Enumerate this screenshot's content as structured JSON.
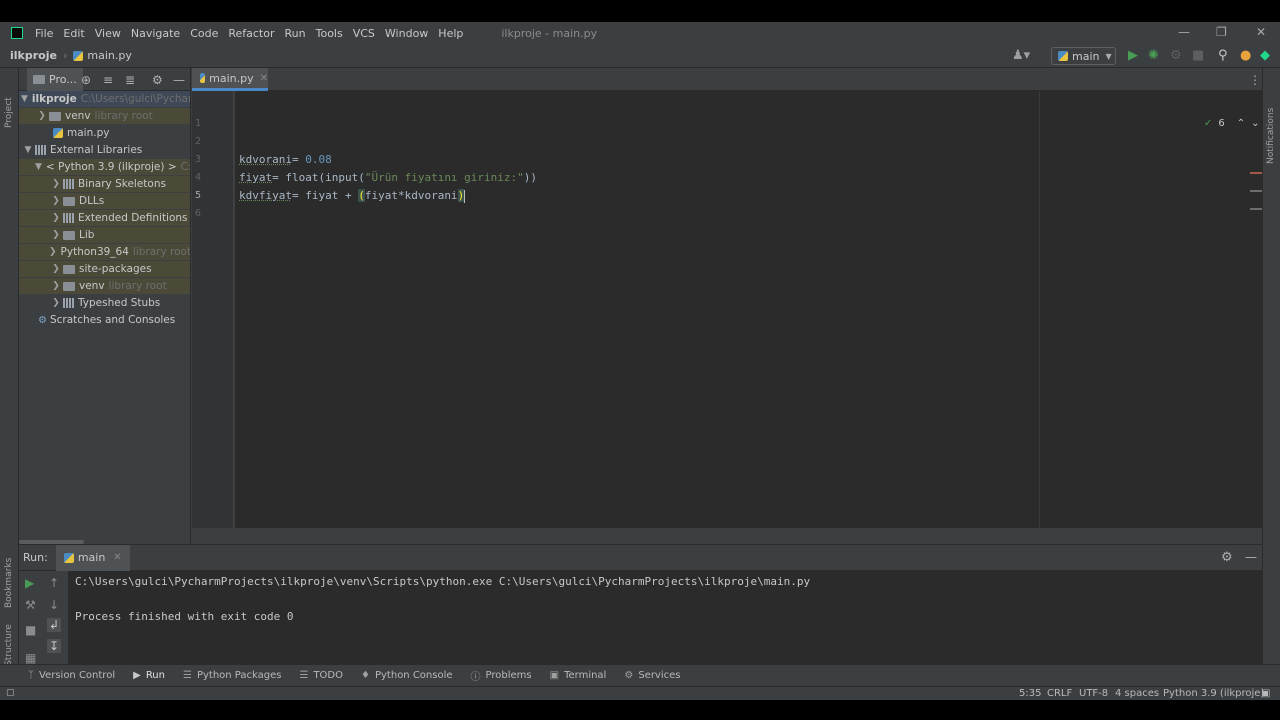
{
  "menu": {
    "items": [
      "File",
      "Edit",
      "View",
      "Navigate",
      "Code",
      "Refactor",
      "Run",
      "Tools",
      "VCS",
      "Window",
      "Help"
    ],
    "window_title": "ilkproje - main.py"
  },
  "navbar": {
    "project": "ilkproje",
    "file": "main.py",
    "run_config": "main"
  },
  "left_stripe": {
    "project": "Project",
    "bookmarks": "Bookmarks",
    "structure": "Structure"
  },
  "right_stripe": {
    "notifications": "Notifications"
  },
  "project_panel": {
    "tab_label": "Pro...",
    "tree": [
      {
        "label": "ilkproje",
        "hint": "C:\\Users\\gulci\\PycharmProjects\\ilkproje"
      },
      {
        "label": "venv",
        "hint": "library root"
      },
      {
        "label": "main.py",
        "hint": ""
      },
      {
        "label": "External Libraries",
        "hint": ""
      },
      {
        "label": "< Python 3.9 (ilkproje) >",
        "hint": "C:\\"
      },
      {
        "label": "Binary Skeletons",
        "hint": ""
      },
      {
        "label": "DLLs",
        "hint": ""
      },
      {
        "label": "Extended Definitions",
        "hint": ""
      },
      {
        "label": "Lib",
        "hint": ""
      },
      {
        "label": "Python39_64",
        "hint": "library root"
      },
      {
        "label": "site-packages",
        "hint": ""
      },
      {
        "label": "venv",
        "hint": "library root"
      },
      {
        "label": "Typeshed Stubs",
        "hint": ""
      },
      {
        "label": "Scratches and Consoles",
        "hint": ""
      }
    ]
  },
  "editor": {
    "tab": "main.py",
    "line_numbers": [
      "1",
      "2",
      "3",
      "4",
      "5",
      "6"
    ],
    "code": {
      "l3_var": "kdvorani",
      "l3_op": "= ",
      "l3_num": "0.08",
      "l4_var": "fiyat",
      "l4_rest": "= float(input(",
      "l4_str": "\"Ürün fiyatını giriniz:\"",
      "l4_end": "))",
      "l5_var": "kdvfiyat",
      "l5_rest": "= fiyat + ",
      "l5_open": "(",
      "l5_inner": "fiyat*kdvorani",
      "l5_close": ")"
    },
    "inspection_count": "6"
  },
  "run_panel": {
    "title": "Run:",
    "tab": "main",
    "console_lines": [
      "C:\\Users\\gulci\\PycharmProjects\\ilkproje\\venv\\Scripts\\python.exe C:\\Users\\gulci\\PycharmProjects\\ilkproje\\main.py",
      "",
      "Process finished with exit code 0"
    ]
  },
  "tool_windows": [
    "Version Control",
    "Run",
    "Python Packages",
    "TODO",
    "Python Console",
    "Problems",
    "Terminal",
    "Services"
  ],
  "status": {
    "position": "5:35",
    "line_sep": "CRLF",
    "encoding": "UTF-8",
    "indent": "4 spaces",
    "interpreter": "Python 3.9 (ilkproje)"
  },
  "colors": {
    "accent": "#4a88c7",
    "run_green": "#499c54",
    "logo_green": "#21d789",
    "warning": "#e8a33d"
  }
}
